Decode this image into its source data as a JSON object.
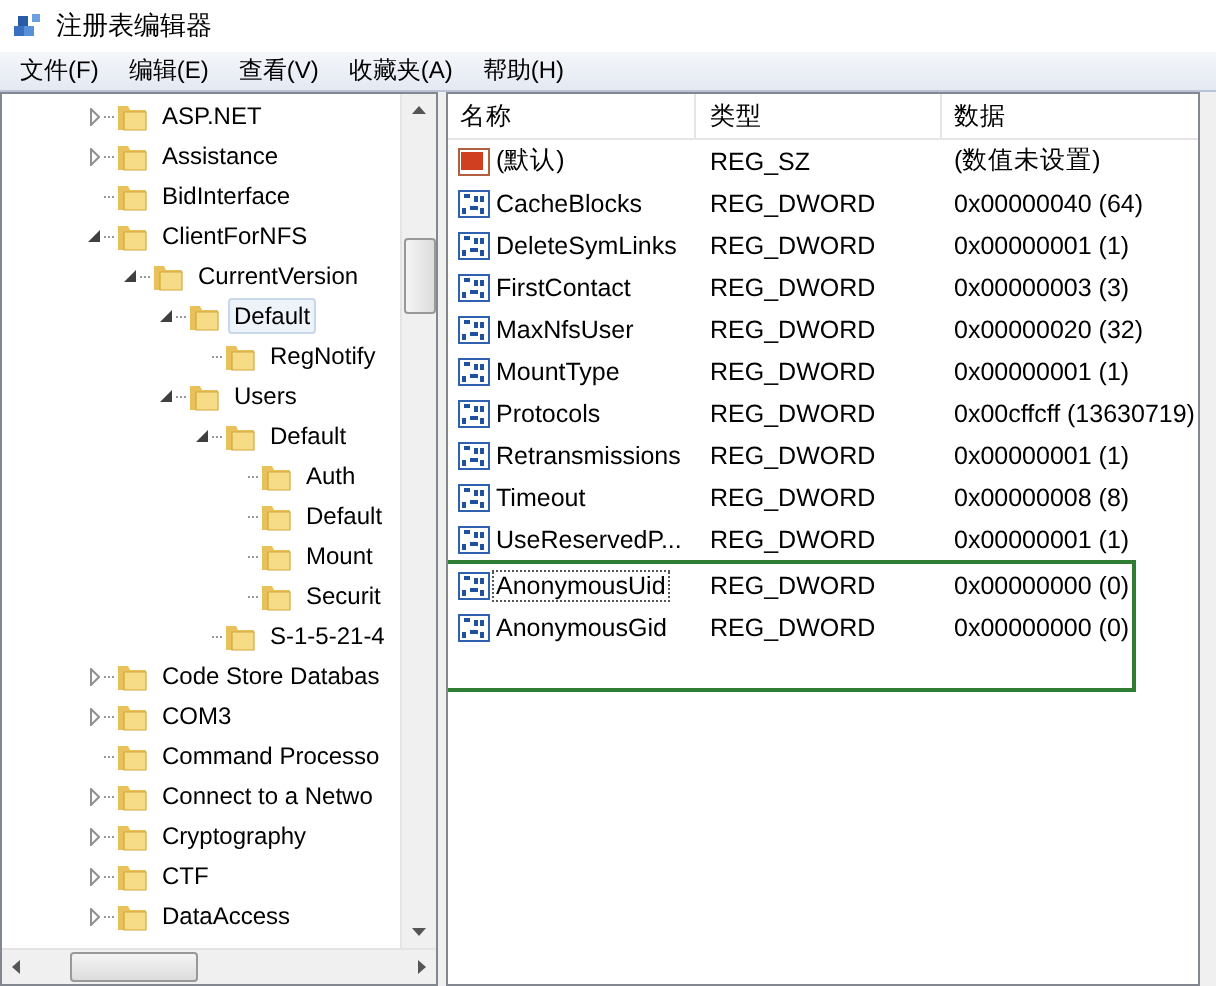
{
  "window": {
    "title": "注册表编辑器"
  },
  "menu": [
    {
      "label": "文件(F)"
    },
    {
      "label": "编辑(E)"
    },
    {
      "label": "查看(V)"
    },
    {
      "label": "收藏夹(A)"
    },
    {
      "label": "帮助(H)"
    }
  ],
  "tree": [
    {
      "label": "ASP.NET",
      "expanded": false,
      "selected": false
    },
    {
      "label": "Assistance",
      "expanded": false,
      "selected": false
    },
    {
      "label": "BidInterface",
      "selected": false
    },
    {
      "label": "ClientForNFS",
      "expanded": true,
      "selected": false,
      "children": [
        {
          "label": "CurrentVersion",
          "expanded": true,
          "selected": false,
          "children": [
            {
              "label": "Default",
              "expanded": true,
              "selected": true,
              "children": [
                {
                  "label": "RegNotify",
                  "selected": false
                }
              ]
            },
            {
              "label": "Users",
              "expanded": true,
              "selected": false,
              "children": [
                {
                  "label": "Default",
                  "expanded": true,
                  "selected": false,
                  "children": [
                    {
                      "label": "Auth",
                      "selected": false
                    },
                    {
                      "label": "Default",
                      "selected": false
                    },
                    {
                      "label": "Mount",
                      "selected": false
                    },
                    {
                      "label": "Securit",
                      "selected": false
                    }
                  ]
                },
                {
                  "label": "S-1-5-21-4",
                  "selected": false
                }
              ]
            }
          ]
        }
      ]
    },
    {
      "label": "Code Store Databas",
      "expanded": false,
      "selected": false
    },
    {
      "label": "COM3",
      "expanded": false,
      "selected": false
    },
    {
      "label": "Command Processo",
      "selected": false
    },
    {
      "label": "Connect to a Netwo",
      "expanded": false,
      "selected": false
    },
    {
      "label": "Cryptography",
      "expanded": false,
      "selected": false
    },
    {
      "label": "CTF",
      "expanded": false,
      "selected": false
    },
    {
      "label": "DataAccess",
      "expanded": false,
      "selected": false
    }
  ],
  "table": {
    "columns": [
      "名称",
      "类型",
      "数据"
    ],
    "rows": [
      {
        "kind": "string",
        "name": "(默认)",
        "type": "REG_SZ",
        "data": "(数值未设置)",
        "highlighted": false,
        "focused": false
      },
      {
        "kind": "binary",
        "name": "CacheBlocks",
        "type": "REG_DWORD",
        "data": "0x00000040 (64)",
        "highlighted": false,
        "focused": false
      },
      {
        "kind": "binary",
        "name": "DeleteSymLinks",
        "type": "REG_DWORD",
        "data": "0x00000001 (1)",
        "highlighted": false,
        "focused": false
      },
      {
        "kind": "binary",
        "name": "FirstContact",
        "type": "REG_DWORD",
        "data": "0x00000003 (3)",
        "highlighted": false,
        "focused": false
      },
      {
        "kind": "binary",
        "name": "MaxNfsUser",
        "type": "REG_DWORD",
        "data": "0x00000020 (32)",
        "highlighted": false,
        "focused": false
      },
      {
        "kind": "binary",
        "name": "MountType",
        "type": "REG_DWORD",
        "data": "0x00000001 (1)",
        "highlighted": false,
        "focused": false
      },
      {
        "kind": "binary",
        "name": "Protocols",
        "type": "REG_DWORD",
        "data": "0x00cffcff (13630719)",
        "highlighted": false,
        "focused": false
      },
      {
        "kind": "binary",
        "name": "Retransmissions",
        "type": "REG_DWORD",
        "data": "0x00000001 (1)",
        "highlighted": false,
        "focused": false
      },
      {
        "kind": "binary",
        "name": "Timeout",
        "type": "REG_DWORD",
        "data": "0x00000008 (8)",
        "highlighted": false,
        "focused": false
      },
      {
        "kind": "binary",
        "name": "UseReservedP...",
        "type": "REG_DWORD",
        "data": "0x00000001 (1)",
        "highlighted": false,
        "focused": false
      },
      {
        "kind": "binary",
        "name": "AnonymousUid",
        "type": "REG_DWORD",
        "data": "0x00000000 (0)",
        "highlighted": true,
        "focused": true
      },
      {
        "kind": "binary",
        "name": "AnonymousGid",
        "type": "REG_DWORD",
        "data": "0x00000000 (0)",
        "highlighted": true,
        "focused": false
      }
    ]
  }
}
